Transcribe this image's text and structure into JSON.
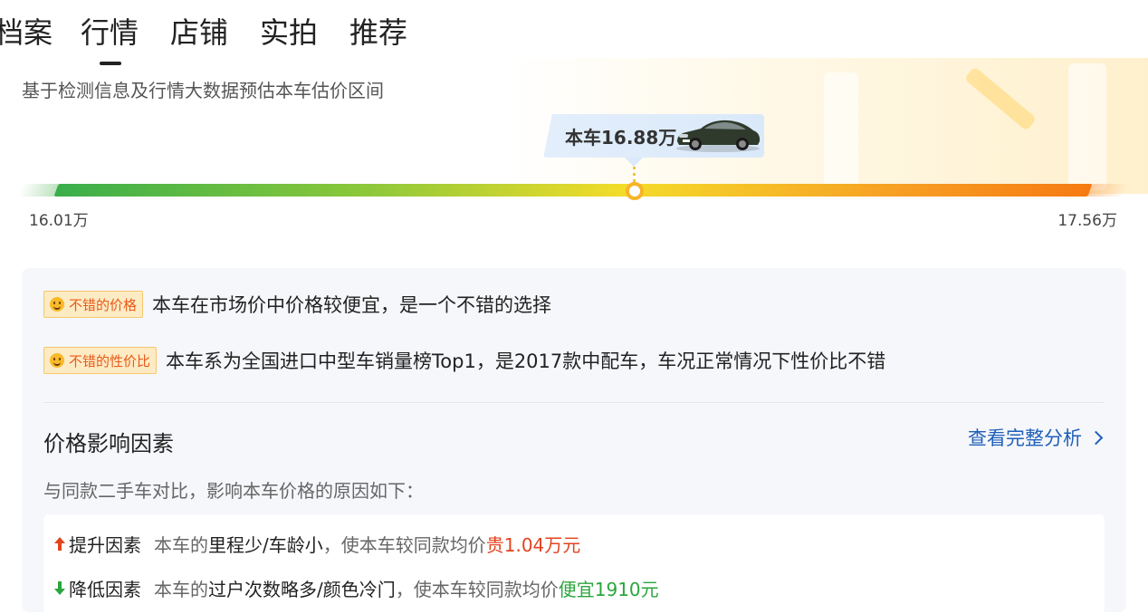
{
  "tabs": [
    {
      "label": "档案",
      "active": false
    },
    {
      "label": "行情",
      "active": true
    },
    {
      "label": "店铺",
      "active": false
    },
    {
      "label": "实拍",
      "active": false
    },
    {
      "label": "推荐",
      "active": false
    }
  ],
  "valuation": {
    "subtitle": "基于检测信息及行情大数据预估本车估价区间",
    "current_price": "本车16.88万",
    "min_price": "16.01万",
    "max_price": "17.56万",
    "current_position_fraction": 0.553
  },
  "evaluations": [
    {
      "badge": "不错的价格",
      "icon": "smile-icon",
      "text": "本车在市场价中价格较便宜，是一个不错的选择"
    },
    {
      "badge": "不错的性价比",
      "icon": "smile-icon",
      "text": "本车系为全国进口中型车销量榜Top1，是2017款中配车，车况正常情况下性价比不错"
    }
  ],
  "factors": {
    "title": "价格影响因素",
    "link": "查看完整分析",
    "description": "与同款二手车对比，影响本车价格的原因如下：",
    "items": [
      {
        "direction": "up",
        "label": "提升因素",
        "prefix": "本车的",
        "highlight": "里程少/车龄小",
        "middle": "，使本车较同款均价",
        "value": "贵1.04万元"
      },
      {
        "direction": "down",
        "label": "降低因素",
        "prefix": "本车的",
        "highlight": "过户次数略多/颜色冷门",
        "middle": "，使本车较同款均价",
        "value": "便宜1910元"
      }
    ]
  },
  "colors": {
    "link": "#1f5fb8",
    "up": "#e2431f",
    "down": "#2aa63c",
    "badge_text": "#e85a1a"
  }
}
